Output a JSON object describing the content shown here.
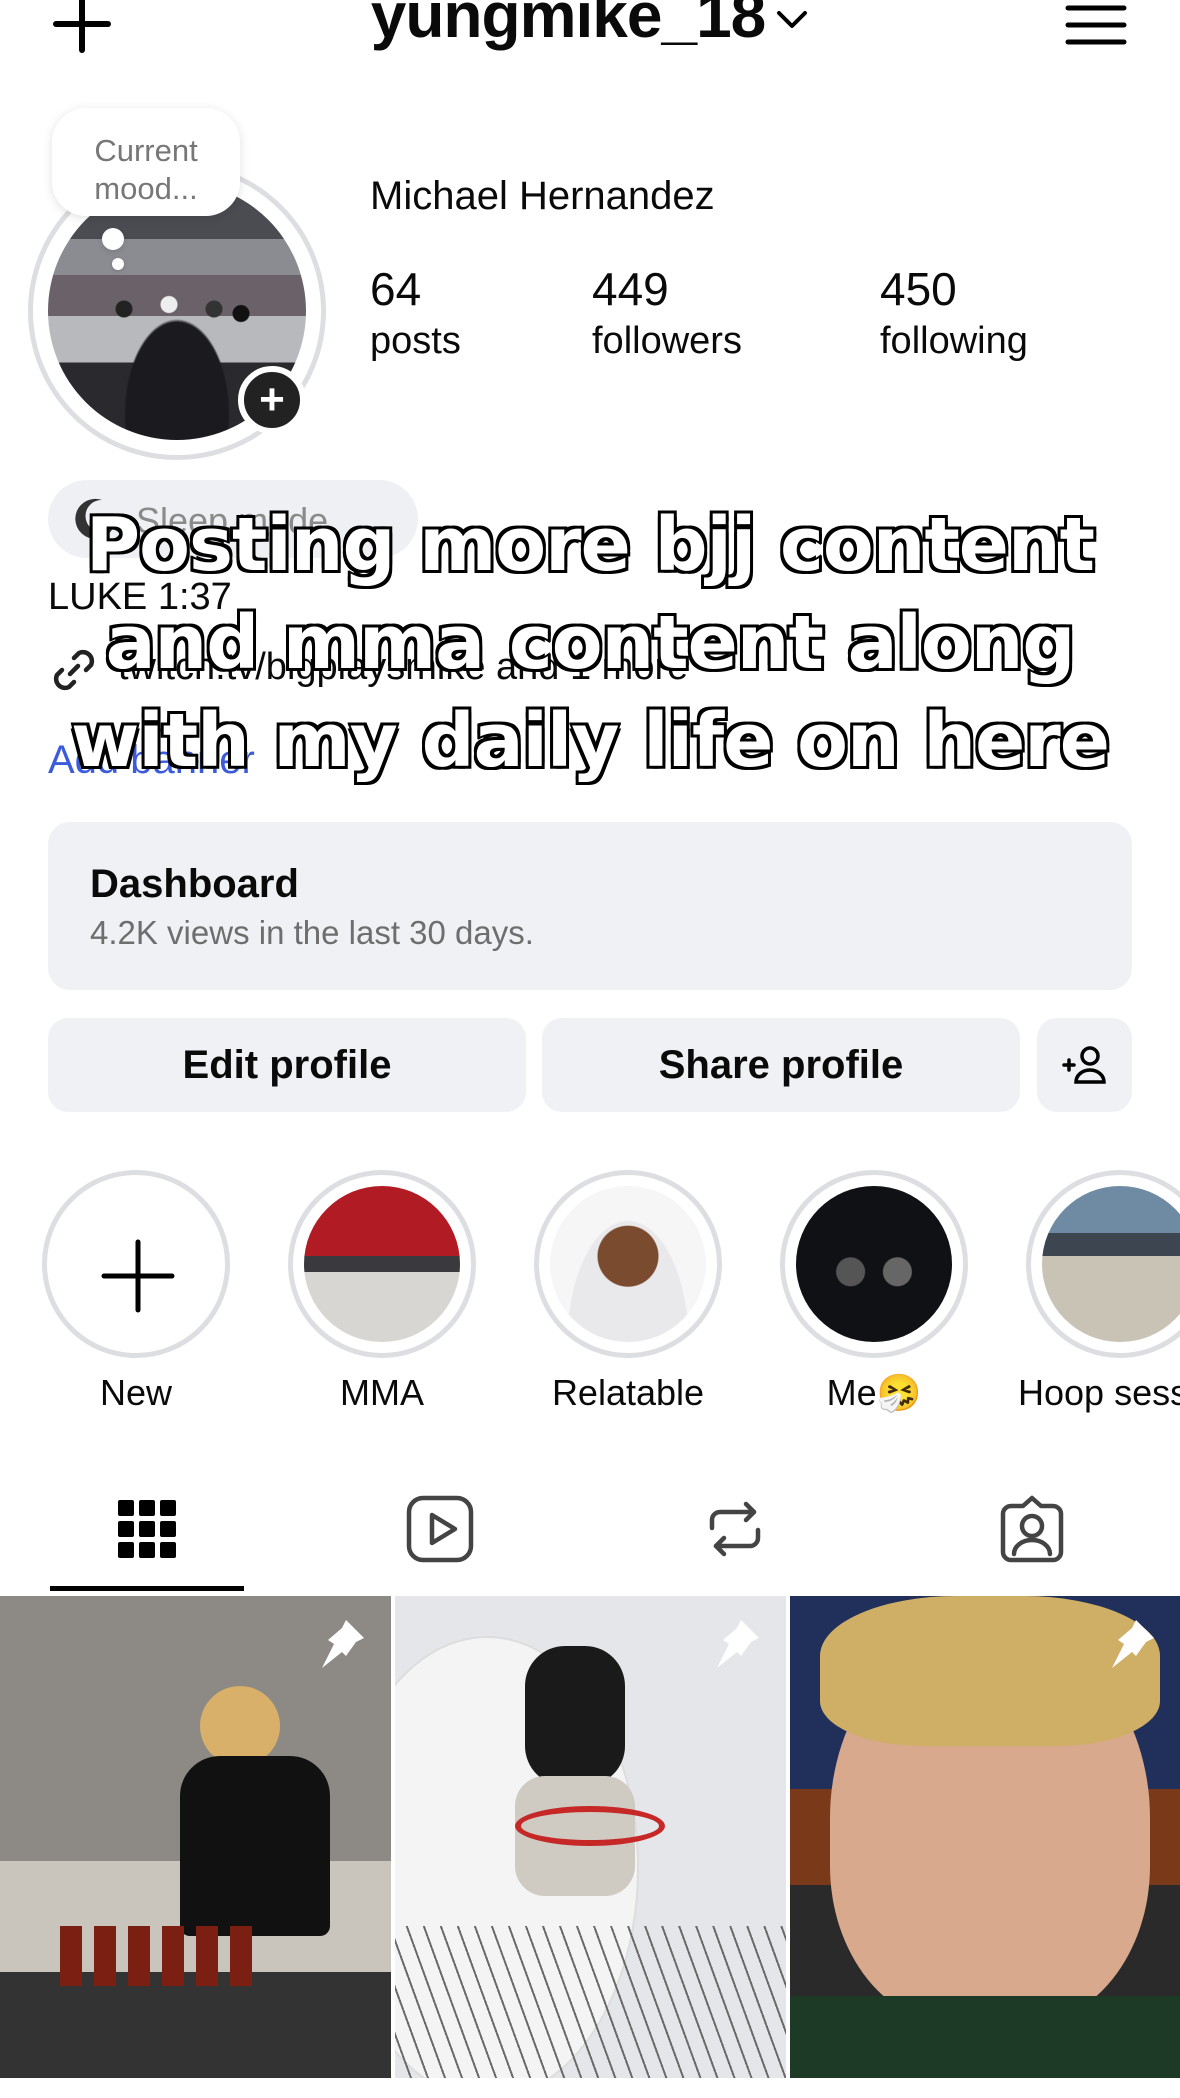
{
  "header": {
    "username": "yungmike_18",
    "icons": {
      "create": "plus-icon",
      "switcher": "chevron-down-icon",
      "menu": "menu-icon"
    }
  },
  "profile": {
    "mood_note": "Current mood...",
    "full_name": "Michael Hernandez",
    "stats": [
      {
        "value": "64",
        "label": "posts"
      },
      {
        "value": "449",
        "label": "followers"
      },
      {
        "value": "450",
        "label": "following"
      }
    ],
    "note_pill": "Sleep mode",
    "bio_line": "LUKE 1:37",
    "link": "twitch.tv/bigplaysmike and 1 more",
    "add_link": "Add banner"
  },
  "overlay_caption": {
    "lines": [
      "Posting more bjj content",
      "and mma content along",
      "with my daily life on here"
    ]
  },
  "dashboard": {
    "title": "Dashboard",
    "subtitle": "4.2K views in the last 30 days."
  },
  "buttons": {
    "edit": "Edit profile",
    "share": "Share profile"
  },
  "highlights": [
    {
      "label": "New"
    },
    {
      "label": "MMA"
    },
    {
      "label": "Relatable"
    },
    {
      "label": "Me🤧"
    },
    {
      "label": "Hoop sessions"
    }
  ],
  "tabs": [
    "grid-icon",
    "reels-icon",
    "reposts-icon",
    "tagged-icon"
  ],
  "colors": {
    "link_blue": "#3b5bdb",
    "surface": "#eff1f4",
    "ring": "#dcdee2"
  }
}
